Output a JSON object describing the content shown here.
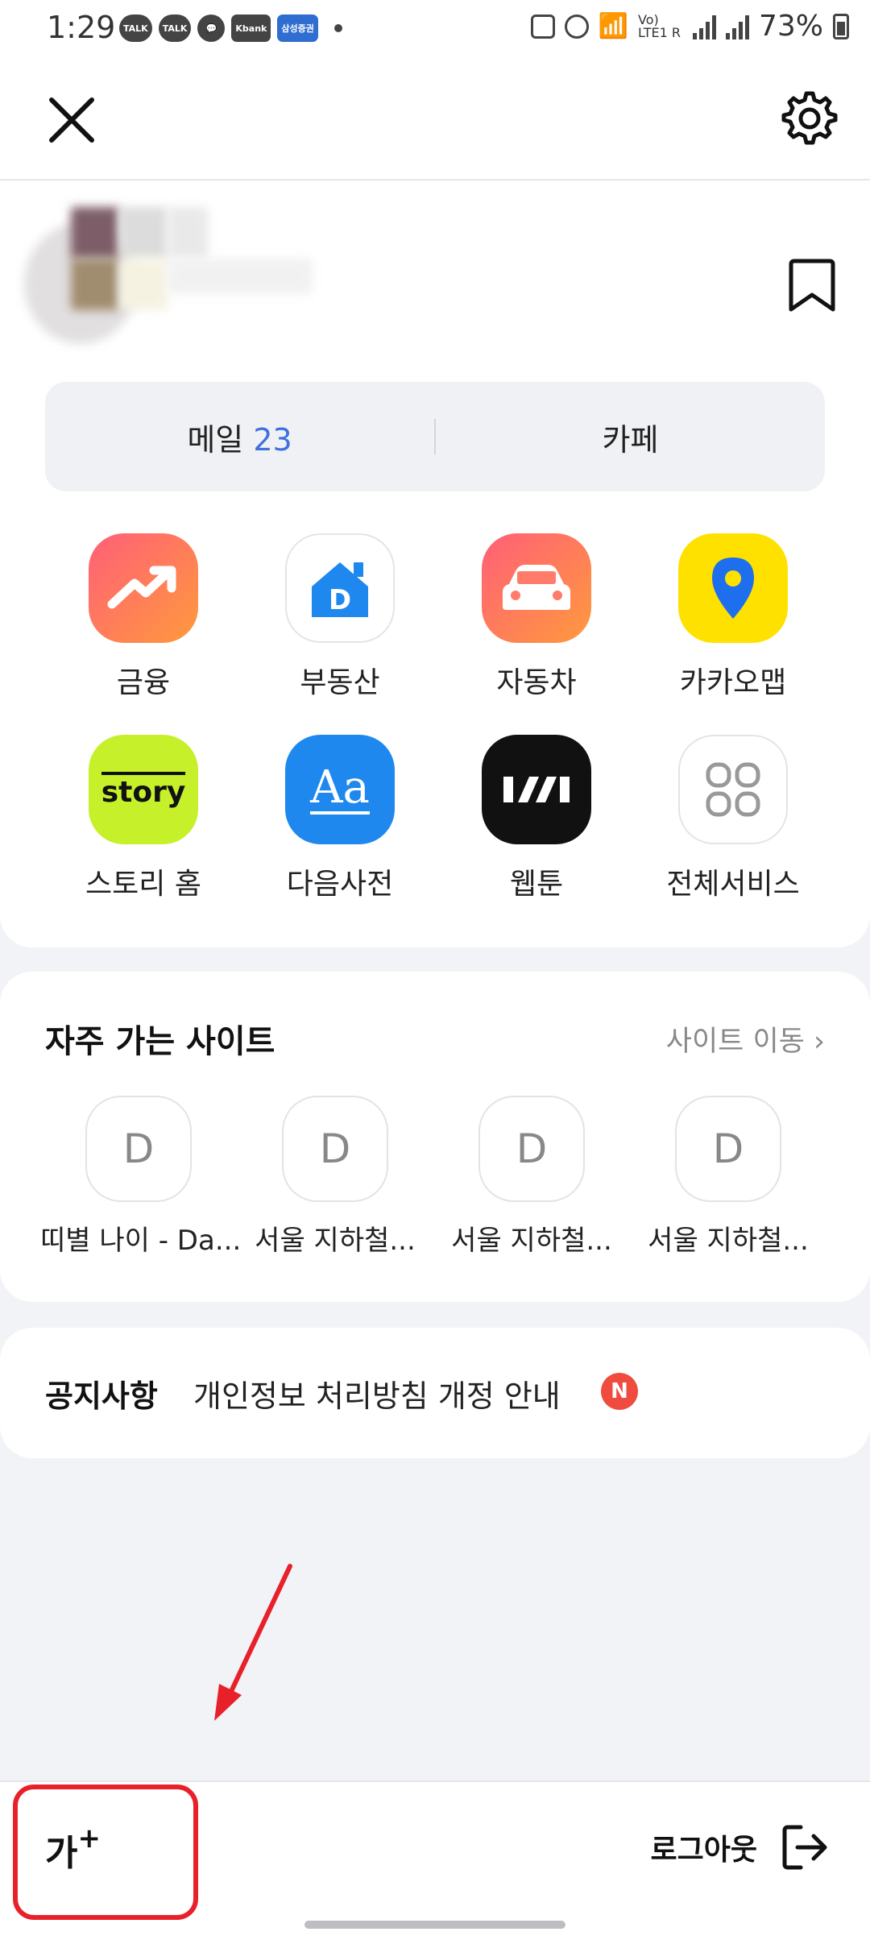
{
  "status_bar": {
    "time": "1:29",
    "notifications": [
      "TALK",
      "TALK",
      "Kbank",
      "삼성증권"
    ],
    "carrier": "Vo) LTE1 R",
    "battery": "73%"
  },
  "header": {
    "close_icon": "close-icon",
    "settings_icon": "gear-icon"
  },
  "profile": {
    "bookmark_icon": "bookmark-icon"
  },
  "tabs": {
    "mail_label": "메일",
    "mail_count": "23",
    "cafe_label": "카페"
  },
  "services": [
    {
      "label": "금융",
      "icon": "finance-trend-icon",
      "color": "#f96a5f"
    },
    {
      "label": "부동산",
      "icon": "realestate-house-icon",
      "color": "#ffffff"
    },
    {
      "label": "자동차",
      "icon": "car-icon",
      "color": "#f75b61"
    },
    {
      "label": "카카오맵",
      "icon": "map-pin-icon",
      "color": "#ffe100"
    },
    {
      "label": "스토리 홈",
      "icon": "story-icon",
      "color": "#c6f02a",
      "icon_text": "story"
    },
    {
      "label": "다음사전",
      "icon": "dictionary-icon",
      "color": "#1e88ee",
      "icon_text": "Aa"
    },
    {
      "label": "웹툰",
      "icon": "webtoon-icon",
      "color": "#111111"
    },
    {
      "label": "전체서비스",
      "icon": "all-services-icon",
      "color": "#ffffff"
    }
  ],
  "frequent_sites": {
    "title": "자주 가는 사이트",
    "move_label": "사이트 이동 ›",
    "items": [
      {
        "letter": "D",
        "label": "띠별 나이 - Da..."
      },
      {
        "letter": "D",
        "label": "서울 지하철..."
      },
      {
        "letter": "D",
        "label": "서울 지하철..."
      },
      {
        "letter": "D",
        "label": "서울 지하철..."
      }
    ]
  },
  "notice": {
    "title": "공지사항",
    "text": "개인정보 처리방침 개정 안내",
    "badge": "N"
  },
  "bottom_bar": {
    "font_size_label": "가",
    "font_size_plus": "+",
    "logout_label": "로그아웃"
  }
}
